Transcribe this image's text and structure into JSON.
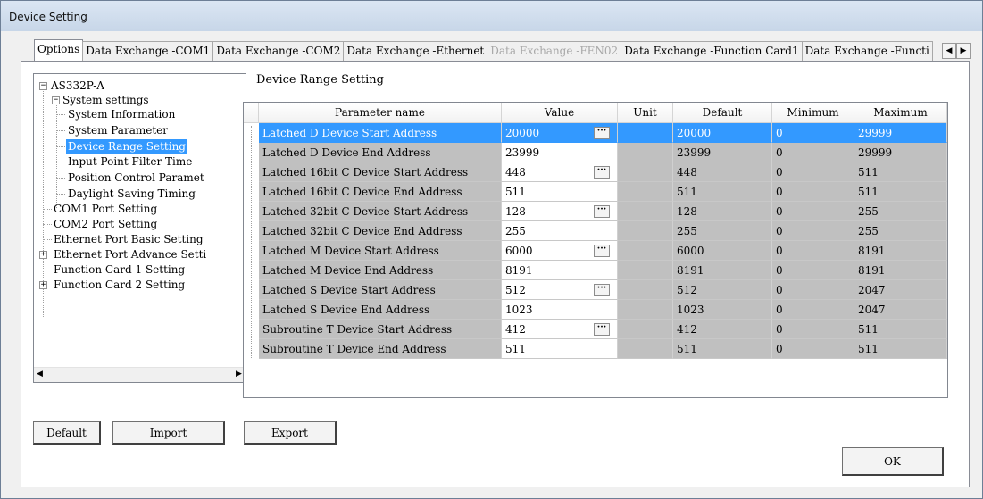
{
  "window": {
    "title": "Device Setting"
  },
  "tabs": [
    {
      "label": "Options",
      "state": "active"
    },
    {
      "label": "Data Exchange -COM1",
      "state": "normal"
    },
    {
      "label": "Data Exchange -COM2",
      "state": "normal"
    },
    {
      "label": "Data Exchange -Ethernet",
      "state": "normal"
    },
    {
      "label": "Data Exchange -FEN02",
      "state": "disabled"
    },
    {
      "label": "Data Exchange -Function Card1",
      "state": "normal"
    },
    {
      "label": "Data Exchange -Functi",
      "state": "normal"
    }
  ],
  "tab_scroll": {
    "left": "◀",
    "right": "▶"
  },
  "tree": {
    "root": "AS332P-A",
    "system_settings": "System settings",
    "items": {
      "system_information": "System Information",
      "system_parameter": "System Parameter",
      "device_range_setting": "Device Range Setting",
      "input_point_filter_time": "Input Point Filter Time",
      "position_control_parameter": "Position Control Paramet",
      "daylight_saving_timing": "Daylight Saving Timing"
    },
    "com1": "COM1 Port Setting",
    "com2": "COM2 Port Setting",
    "ethernet_basic": "Ethernet Port Basic Setting",
    "ethernet_advance": "Ethernet Port Advance Setti",
    "function_card_1": "Function Card 1 Setting",
    "function_card_2": "Function Card 2 Setting",
    "expander_minus": "−",
    "expander_plus": "+",
    "scroll_left": "◀",
    "scroll_right": "▶"
  },
  "section_title": "Device Range Setting",
  "table": {
    "headers": {
      "parameter": "Parameter name",
      "value": "Value",
      "unit": "Unit",
      "default": "Default",
      "minimum": "Minimum",
      "maximum": "Maximum"
    },
    "ellipsis": "···",
    "rows": [
      {
        "name": "Latched D Device Start Address",
        "value": "20000",
        "unit": "",
        "default": "20000",
        "minimum": "0",
        "maximum": "29999"
      },
      {
        "name": "Latched D Device End Address",
        "value": "23999",
        "unit": "",
        "default": "23999",
        "minimum": "0",
        "maximum": "29999"
      },
      {
        "name": "Latched 16bit C Device Start Address",
        "value": "448",
        "unit": "",
        "default": "448",
        "minimum": "0",
        "maximum": "511"
      },
      {
        "name": "Latched 16bit C Device End Address",
        "value": "511",
        "unit": "",
        "default": "511",
        "minimum": "0",
        "maximum": "511"
      },
      {
        "name": "Latched 32bit C Device Start Address",
        "value": "128",
        "unit": "",
        "default": "128",
        "minimum": "0",
        "maximum": "255"
      },
      {
        "name": "Latched 32bit C Device End Address",
        "value": "255",
        "unit": "",
        "default": "255",
        "minimum": "0",
        "maximum": "255"
      },
      {
        "name": "Latched M Device Start Address",
        "value": "6000",
        "unit": "",
        "default": "6000",
        "minimum": "0",
        "maximum": "8191"
      },
      {
        "name": "Latched M Device End Address",
        "value": "8191",
        "unit": "",
        "default": "8191",
        "minimum": "0",
        "maximum": "8191"
      },
      {
        "name": "Latched S Device Start Address",
        "value": "512",
        "unit": "",
        "default": "512",
        "minimum": "0",
        "maximum": "2047"
      },
      {
        "name": "Latched S Device End Address",
        "value": "1023",
        "unit": "",
        "default": "1023",
        "minimum": "0",
        "maximum": "2047"
      },
      {
        "name": "Subroutine T Device Start Address",
        "value": "412",
        "unit": "",
        "default": "412",
        "minimum": "0",
        "maximum": "511"
      },
      {
        "name": "Subroutine T Device End Address",
        "value": "511",
        "unit": "",
        "default": "511",
        "minimum": "0",
        "maximum": "511"
      }
    ]
  },
  "buttons": {
    "default": "Default",
    "import": "Import",
    "export": "Export",
    "ok": "OK"
  },
  "colors": {
    "selection": "#3399ff",
    "readonly_cell": "#c0c0c0"
  }
}
